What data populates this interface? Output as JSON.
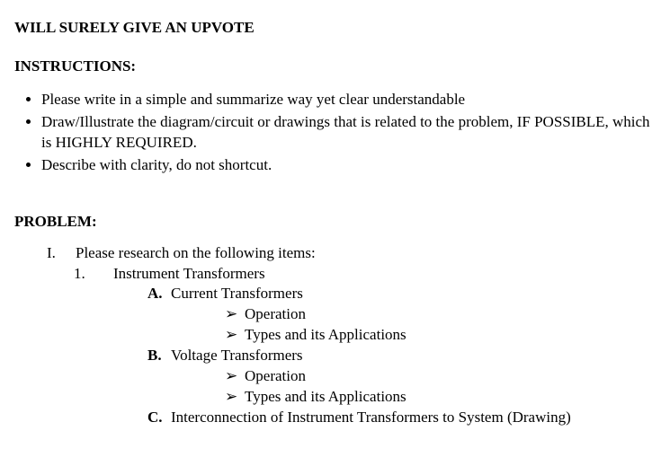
{
  "title": "WILL SURELY GIVE AN UPVOTE",
  "instructions_heading": "INSTRUCTIONS:",
  "instructions": [
    "Please write in a simple and summarize way yet clear understandable",
    "Draw/Illustrate the diagram/circuit or drawings that is related to the problem, IF POSSIBLE, which is HIGHLY REQUIRED.",
    "Describe with clarity, do not shortcut."
  ],
  "problem_heading": "PROBLEM:",
  "roman": "I.",
  "roman_text": "Please research on the following items:",
  "num1": "1.",
  "num1_text": "Instrument Transformers",
  "A": {
    "letter": "A.",
    "text": "Current Transformers",
    "sub1": "Operation",
    "sub2": "Types and its Applications"
  },
  "B": {
    "letter": "B.",
    "text": "Voltage Transformers",
    "sub1": "Operation",
    "sub2": "Types and its Applications"
  },
  "C": {
    "letter": "C.",
    "text": "Interconnection of Instrument Transformers to System (Drawing)"
  },
  "arrow": "➢"
}
